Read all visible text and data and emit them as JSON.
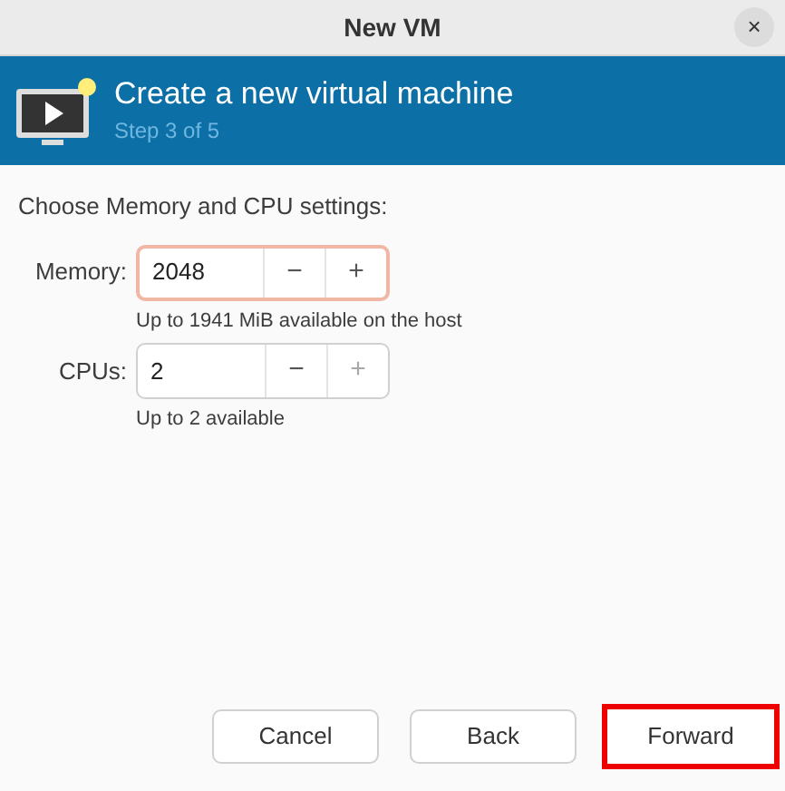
{
  "window": {
    "title": "New VM",
    "close": "×"
  },
  "banner": {
    "title": "Create a new virtual machine",
    "step": "Step 3 of 5"
  },
  "heading": "Choose Memory and CPU settings:",
  "fields": [
    {
      "label": "Memory:",
      "value": "2048",
      "focused": true,
      "minus": "−",
      "plus": "+",
      "minus_disabled": false,
      "plus_disabled": false,
      "hint": "Up to 1941 MiB available on the host"
    },
    {
      "label": "CPUs:",
      "value": "2",
      "focused": false,
      "minus": "−",
      "plus": "+",
      "minus_disabled": false,
      "plus_disabled": true,
      "hint": "Up to 2 available"
    }
  ],
  "buttons": [
    {
      "label": "Cancel",
      "highlighted": false
    },
    {
      "label": "Back",
      "highlighted": false
    },
    {
      "label": "Forward",
      "highlighted": true
    }
  ]
}
